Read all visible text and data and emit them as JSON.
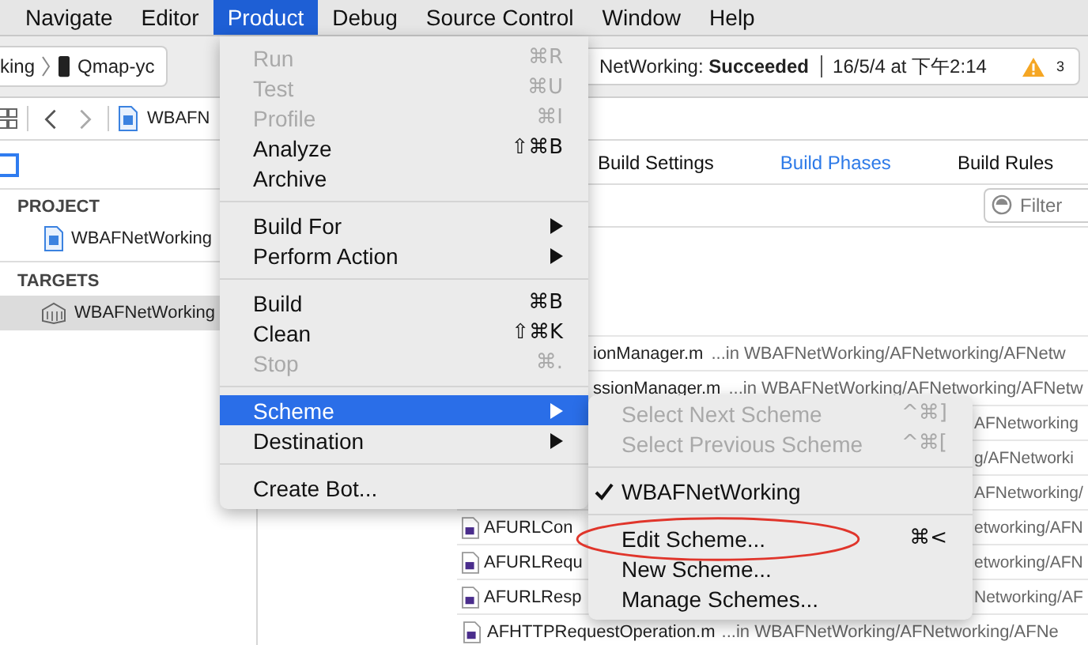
{
  "menu_bar": [
    {
      "label": "Navigate",
      "selected": false
    },
    {
      "label": "Editor",
      "selected": false
    },
    {
      "label": "Product",
      "selected": true
    },
    {
      "label": "Debug",
      "selected": false
    },
    {
      "label": "Source Control",
      "selected": false
    },
    {
      "label": "Window",
      "selected": false
    },
    {
      "label": "Help",
      "selected": false
    }
  ],
  "toolbar": {
    "scheme_tail": "king",
    "device": "Qmap-yc",
    "status": "NetWorking: **Succeeded**",
    "timestamp": "16/5/4 at 下午2:14",
    "warning_count": "3"
  },
  "jump_bar": {
    "file": "WBAFN"
  },
  "navigator": {
    "sections": [
      {
        "title": "PROJECT",
        "items": [
          {
            "label": "WBAFNetWorking",
            "kind": "project",
            "selected": false
          }
        ]
      },
      {
        "title": "TARGETS",
        "items": [
          {
            "label": "WBAFNetWorking",
            "kind": "target",
            "selected": true
          }
        ]
      }
    ]
  },
  "editor_tabs": [
    {
      "label": "Build Settings",
      "selected": false
    },
    {
      "label": "Build Phases",
      "selected": true
    },
    {
      "label": "Build Rules",
      "selected": false
    }
  ],
  "filter": {
    "placeholder": "Filter"
  },
  "files": [
    {
      "kind": "above",
      "name": "ionManager.m",
      "path": "...in WBAFNetWorking/AFNetworking/AFNetw"
    },
    {
      "kind": "above",
      "name": "ssionManager.m",
      "path": "...in WBAFNetWorking/AFNetworking/AFNetw"
    },
    {
      "kind": "split",
      "path": "AFNetworking"
    },
    {
      "kind": "split",
      "path": "g/AFNetworki"
    },
    {
      "kind": "split",
      "path": "AFNetworking/"
    },
    {
      "kind": "split",
      "name": "AFURLCon",
      "path": "etworking/AFN"
    },
    {
      "kind": "split",
      "name": "AFURLRequ",
      "path": "etworking/AFN"
    },
    {
      "kind": "split",
      "name": "AFURLResp",
      "path": "Networking/AF"
    },
    {
      "kind": "full",
      "name": "AFHTTPRequestOperation.m",
      "path": "...in WBAFNetWorking/AFNetworking/AFNe"
    }
  ],
  "product_menu": [
    {
      "kind": "item",
      "label": "Run",
      "shortcut": "⌘R",
      "disabled": true,
      "submenu": false,
      "selected": false
    },
    {
      "kind": "item",
      "label": "Test",
      "shortcut": "⌘U",
      "disabled": true,
      "submenu": false,
      "selected": false
    },
    {
      "kind": "item",
      "label": "Profile",
      "shortcut": "⌘I",
      "disabled": true,
      "submenu": false,
      "selected": false
    },
    {
      "kind": "item",
      "label": "Analyze",
      "shortcut": "⇧⌘B",
      "disabled": false,
      "submenu": false,
      "selected": false
    },
    {
      "kind": "item",
      "label": "Archive",
      "disabled": false,
      "submenu": false,
      "selected": false
    },
    {
      "kind": "separator"
    },
    {
      "kind": "item",
      "label": "Build For",
      "disabled": false,
      "submenu": true,
      "selected": false
    },
    {
      "kind": "item",
      "label": "Perform Action",
      "disabled": false,
      "submenu": true,
      "selected": false
    },
    {
      "kind": "separator"
    },
    {
      "kind": "item",
      "label": "Build",
      "shortcut": "⌘B",
      "disabled": false,
      "submenu": false,
      "selected": false
    },
    {
      "kind": "item",
      "label": "Clean",
      "shortcut": "⇧⌘K",
      "disabled": false,
      "submenu": false,
      "selected": false
    },
    {
      "kind": "item",
      "label": "Stop",
      "shortcut": "⌘.",
      "disabled": true,
      "submenu": false,
      "selected": false
    },
    {
      "kind": "separator"
    },
    {
      "kind": "item",
      "label": "Scheme",
      "disabled": false,
      "submenu": true,
      "selected": true
    },
    {
      "kind": "item",
      "label": "Destination",
      "disabled": false,
      "submenu": true,
      "selected": false
    },
    {
      "kind": "separator"
    },
    {
      "kind": "item",
      "label": "Create Bot...",
      "disabled": false,
      "submenu": false,
      "selected": false
    }
  ],
  "scheme_menu": [
    {
      "kind": "item",
      "label": "Select Next Scheme",
      "shortcut": "^⌘]",
      "disabled": true,
      "checked": false
    },
    {
      "kind": "item",
      "label": "Select Previous Scheme",
      "shortcut": "^⌘[",
      "disabled": true,
      "checked": false
    },
    {
      "kind": "separator"
    },
    {
      "kind": "item",
      "label": "WBAFNetWorking",
      "disabled": false,
      "checked": true
    },
    {
      "kind": "separator"
    },
    {
      "kind": "item",
      "label": "Edit Scheme...",
      "shortcut": "⌘<",
      "disabled": false,
      "checked": false
    },
    {
      "kind": "item",
      "label": "New Scheme...",
      "disabled": false,
      "checked": false
    },
    {
      "kind": "item",
      "label": "Manage Schemes...",
      "disabled": false,
      "checked": false
    }
  ]
}
